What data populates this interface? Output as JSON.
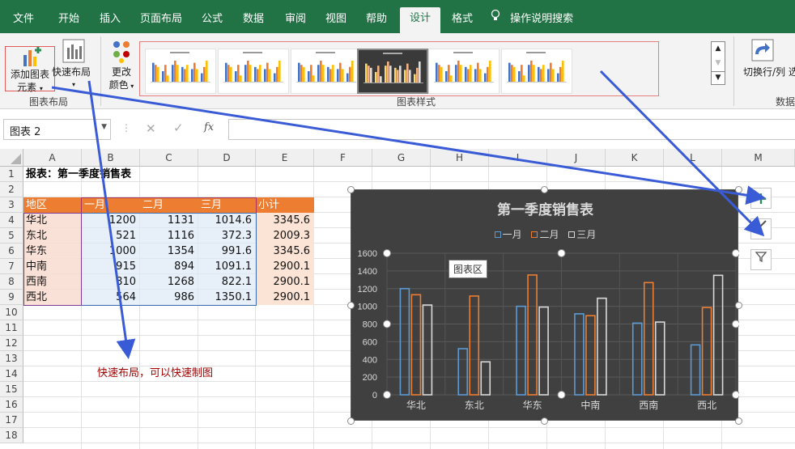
{
  "ribbon": {
    "tabs": [
      "文件",
      "开始",
      "插入",
      "页面布局",
      "公式",
      "数据",
      "审阅",
      "视图",
      "帮助",
      "设计",
      "格式"
    ],
    "tell_me": "操作说明搜索",
    "add_element_line1": "添加图表",
    "add_element_line2": "元素",
    "quick_layout": "快速布局",
    "change_colors_line1": "更改",
    "change_colors_line2": "颜色",
    "group_layout": "图表布局",
    "group_styles": "图表样式",
    "switch_rowcol": "切换行/列",
    "switch_rowcol_cut": "选",
    "group_data": "数据"
  },
  "formula_bar": {
    "name_box": "图表 2",
    "fx": "fx"
  },
  "grid": {
    "columns": [
      "A",
      "B",
      "C",
      "D",
      "E",
      "F",
      "G",
      "H",
      "I",
      "J",
      "K",
      "L",
      "M"
    ],
    "rows": [
      "1",
      "2",
      "3",
      "4",
      "5",
      "6",
      "7",
      "8",
      "9",
      "10",
      "11",
      "12",
      "13",
      "14",
      "15",
      "16",
      "17",
      "18"
    ],
    "title": "报表：第一季度销售表",
    "headers": [
      "地区",
      "一月",
      "二月",
      "三月",
      "小计"
    ],
    "data": [
      [
        "华北",
        "1200",
        "1131",
        "1014.6",
        "3345.6"
      ],
      [
        "东北",
        "521",
        "1116",
        "372.3",
        "2009.3"
      ],
      [
        "华东",
        "1000",
        "1354",
        "991.6",
        "3345.6"
      ],
      [
        "中南",
        "915",
        "894",
        "1091.1",
        "2900.1"
      ],
      [
        "西南",
        "810",
        "1268",
        "822.1",
        "2900.1"
      ],
      [
        "西北",
        "564",
        "986",
        "1350.1",
        "2900.1"
      ]
    ]
  },
  "annotation": "快速布局，可以快速制图",
  "colors": {
    "ribbon_green": "#217346",
    "header_orange": "#ed7d31",
    "series1": "#5b9bd5",
    "series2": "#ed7d31",
    "series3": "#d9d9d9",
    "arrow": "#3a5bd6"
  },
  "chart_data": {
    "type": "bar",
    "title": "第一季度销售表",
    "categories": [
      "华北",
      "东北",
      "华东",
      "中南",
      "西南",
      "西北"
    ],
    "series": [
      {
        "name": "一月",
        "values": [
          1200,
          521,
          1000,
          915,
          810,
          564
        ]
      },
      {
        "name": "二月",
        "values": [
          1131,
          1116,
          1354,
          894,
          1268,
          986
        ]
      },
      {
        "name": "三月",
        "values": [
          1014.6,
          372.3,
          991.6,
          1091.1,
          822.1,
          1350.1
        ]
      }
    ],
    "ylim": [
      0,
      1600
    ],
    "yticks": [
      0,
      200,
      400,
      600,
      800,
      1000,
      1200,
      1400,
      1600
    ],
    "legend": "top",
    "tooltip": "图表区"
  }
}
